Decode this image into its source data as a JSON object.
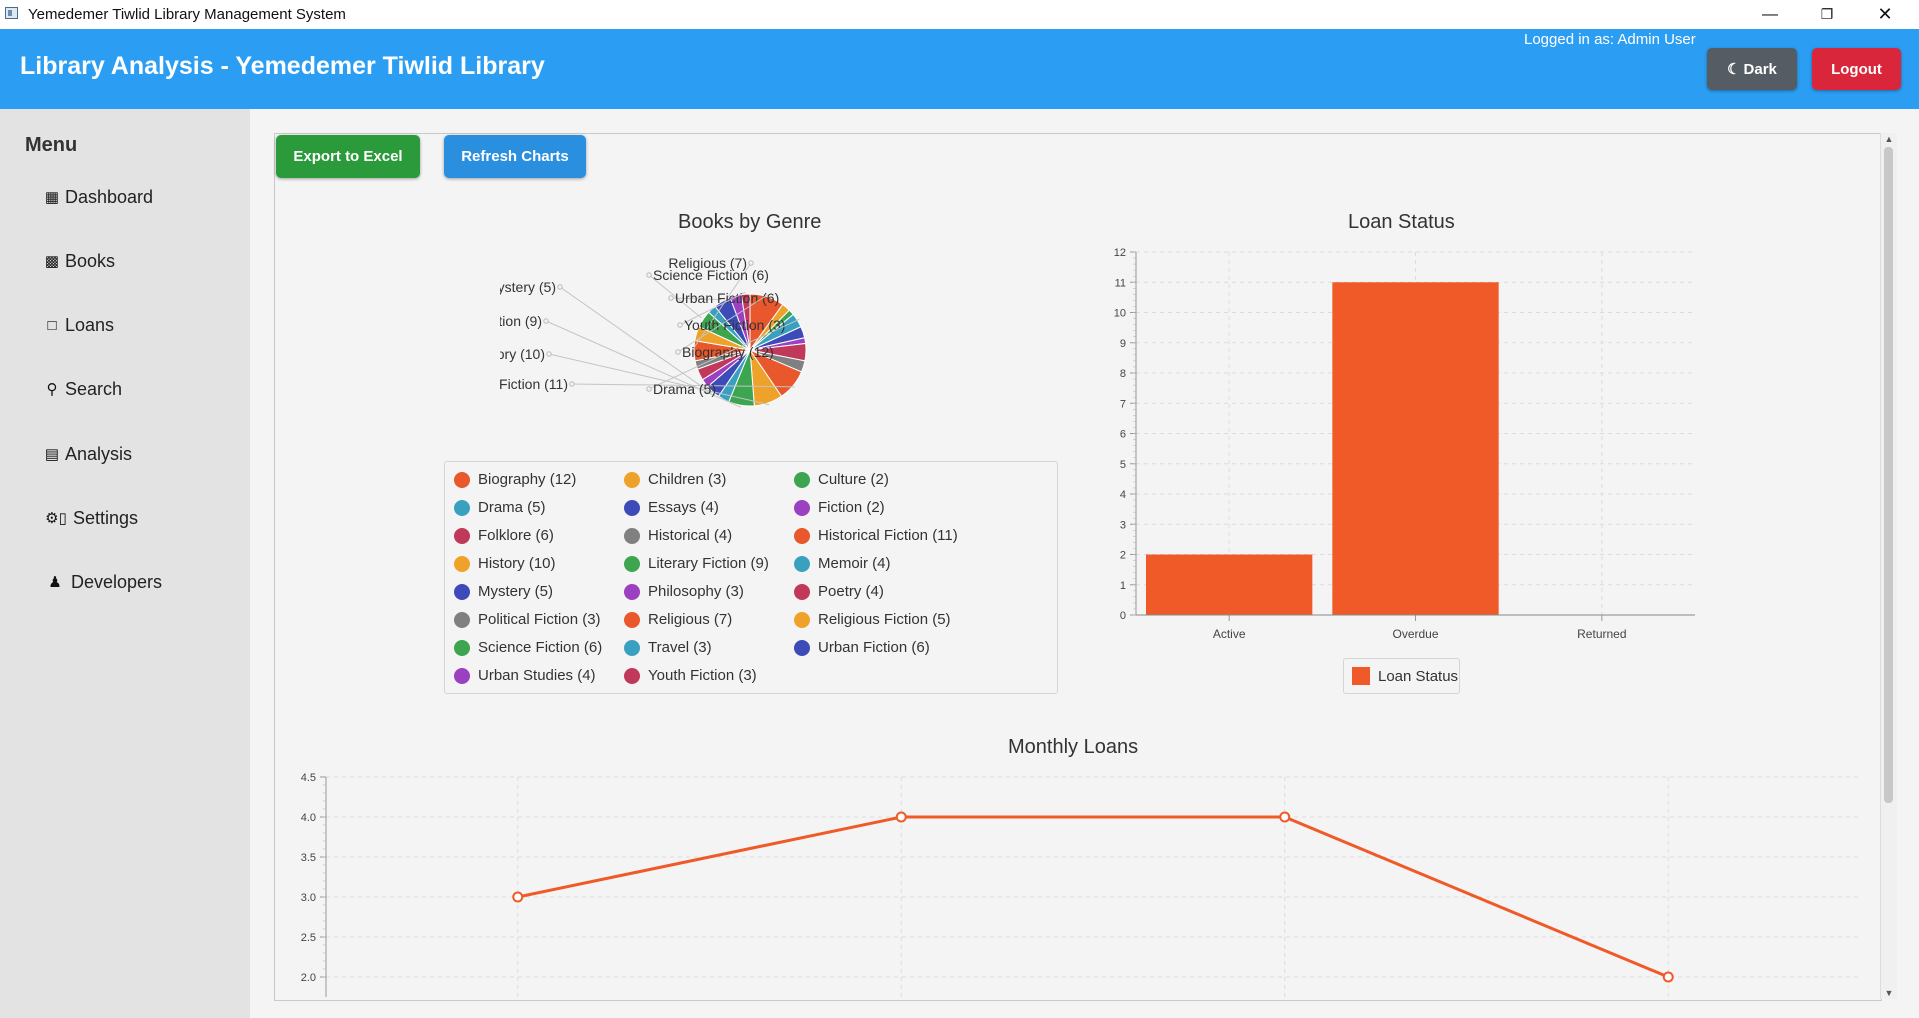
{
  "window": {
    "title": "Yemedemer Tiwlid Library Management System"
  },
  "header": {
    "title": "Library Analysis - Yemedemer Tiwlid Library",
    "logged_in": "Logged in as: Admin User",
    "dark_label": "Dark",
    "logout_label": "Logout"
  },
  "sidebar": {
    "title": "Menu",
    "items": [
      {
        "label": "Dashboard",
        "icon": "dashboard-icon"
      },
      {
        "label": "Books",
        "icon": "books-icon"
      },
      {
        "label": "Loans",
        "icon": "open-book-icon"
      },
      {
        "label": "Search",
        "icon": "search-icon"
      },
      {
        "label": "Analysis",
        "icon": "chart-icon"
      },
      {
        "label": "Settings",
        "icon": "settings-icon"
      },
      {
        "label": "Developers",
        "icon": "developer-icon"
      }
    ]
  },
  "toolbar": {
    "export_label": "Export to Excel",
    "refresh_label": "Refresh Charts"
  },
  "colors": {
    "accent": "#f05a28",
    "header": "#2b9ef3",
    "export": "#2a9a3a",
    "refresh": "#2b8fe0",
    "logout": "#d9263a"
  },
  "chart_data": [
    {
      "type": "pie",
      "title": "Books by Genre",
      "legend_placement": "bottom",
      "slices": [
        {
          "label": "Biography (12)",
          "value": 12,
          "color": "#e8582c"
        },
        {
          "label": "Children (3)",
          "value": 3,
          "color": "#efa22a"
        },
        {
          "label": "Culture (2)",
          "value": 2,
          "color": "#3da54f"
        },
        {
          "label": "Drama (5)",
          "value": 5,
          "color": "#3aa0bf"
        },
        {
          "label": "Essays (4)",
          "value": 4,
          "color": "#3d4bb8"
        },
        {
          "label": "Fiction (2)",
          "value": 2,
          "color": "#9b40c0"
        },
        {
          "label": "Folklore (6)",
          "value": 6,
          "color": "#c0385a"
        },
        {
          "label": "Historical (4)",
          "value": 4,
          "color": "#808080"
        },
        {
          "label": "Historical Fiction (11)",
          "value": 11,
          "color": "#e8582c"
        },
        {
          "label": "History (10)",
          "value": 10,
          "color": "#efa22a"
        },
        {
          "label": "Literary Fiction (9)",
          "value": 9,
          "color": "#3da54f"
        },
        {
          "label": "Memoir (4)",
          "value": 4,
          "color": "#3aa0bf"
        },
        {
          "label": "Mystery (5)",
          "value": 5,
          "color": "#3d4bb8"
        },
        {
          "label": "Philosophy (3)",
          "value": 3,
          "color": "#9b40c0"
        },
        {
          "label": "Poetry (4)",
          "value": 4,
          "color": "#c0385a"
        },
        {
          "label": "Political Fiction (3)",
          "value": 3,
          "color": "#808080"
        },
        {
          "label": "Religious (7)",
          "value": 7,
          "color": "#e8582c"
        },
        {
          "label": "Religious Fiction (5)",
          "value": 5,
          "color": "#efa22a"
        },
        {
          "label": "Science Fiction (6)",
          "value": 6,
          "color": "#3da54f"
        },
        {
          "label": "Travel (3)",
          "value": 3,
          "color": "#3aa0bf"
        },
        {
          "label": "Urban Fiction (6)",
          "value": 6,
          "color": "#3d4bb8"
        },
        {
          "label": "Urban Studies (4)",
          "value": 4,
          "color": "#9b40c0"
        },
        {
          "label": "Youth Fiction (3)",
          "value": 3,
          "color": "#c0385a"
        }
      ]
    },
    {
      "type": "bar",
      "title": "Loan Status",
      "categories": [
        "Active",
        "Overdue",
        "Returned"
      ],
      "series": [
        {
          "name": "Loan Status",
          "values": [
            2,
            11,
            0
          ]
        }
      ],
      "ylim": [
        0,
        12
      ],
      "yticks": [
        0,
        1,
        2,
        3,
        4,
        5,
        6,
        7,
        8,
        9,
        10,
        11,
        12
      ],
      "grid": true,
      "legend_placement": "bottom"
    },
    {
      "type": "line",
      "title": "Monthly Loans",
      "values": [
        3.0,
        4.0,
        4.0,
        2.0
      ],
      "ylim": [
        2.0,
        4.5
      ],
      "yticks": [
        "2.0",
        "2.5",
        "3.0",
        "3.5",
        "4.0",
        "4.5"
      ],
      "grid": true
    }
  ]
}
